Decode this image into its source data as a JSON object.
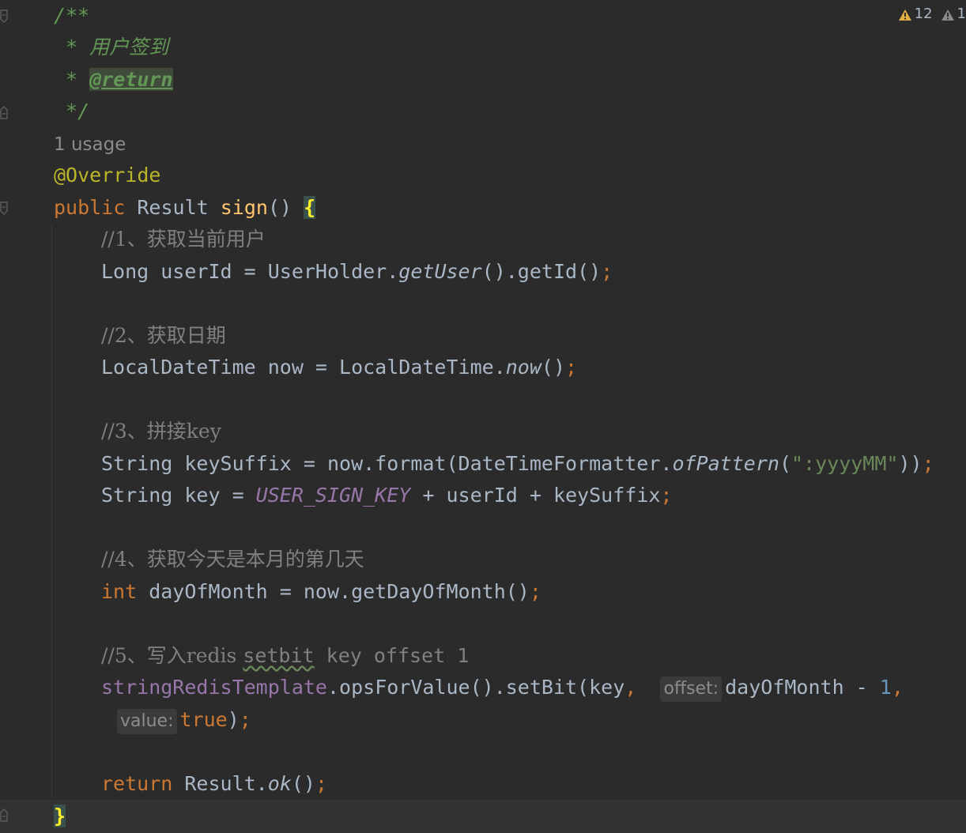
{
  "inspection": {
    "warnings_count": "12",
    "weak_warnings_count": "1"
  },
  "code": {
    "doc_open": "/**",
    "doc_title_prefix": " * ",
    "doc_title": "用户签到",
    "doc_tag_prefix": " * ",
    "doc_tag": "@return",
    "doc_close": " */",
    "usage_hint": "1 usage",
    "annotation": "@Override",
    "sig_public": "public",
    "sig_type": " Result ",
    "sig_method": "sign",
    "sig_parens": "() ",
    "sig_brace": "{",
    "comment1": "//1、获取当前用户",
    "l1_type": "Long userId = UserHolder.",
    "l1_static": "getUser",
    "l1_rest": "().getId()",
    "semi": ";",
    "comment2": "//2、获取日期",
    "l2_type": "LocalDateTime now = LocalDateTime.",
    "l2_static": "now",
    "l2_rest": "()",
    "comment3": "//3、拼接key",
    "l3_a": "String keySuffix = now.format(DateTimeFormatter.",
    "l3_static": "ofPattern",
    "l3_open": "(",
    "l3_str": "\":yyyyMM\"",
    "l3_close": "))",
    "l4_a": "String key = ",
    "l4_const": "USER_SIGN_KEY",
    "l4_b": " + userId + keySuffix",
    "comment4": "//4、获取今天是本月的第几天",
    "l5_kw": "int",
    "l5_rest": " dayOfMonth = now.getDayOfMonth()",
    "comment5_a": "//5、写入redis ",
    "comment5_typo": "setbit",
    "comment5_b": " key offset 1",
    "l6_field": "stringRedisTemplate",
    "l6_a": ".opsForValue().setBit(key",
    "comma": ",",
    "hint_offset": "offset:",
    "l6_b": "dayOfMonth - ",
    "l6_num": "1",
    "hint_value": "value:",
    "l7_kw": "true",
    "l7_close": ")",
    "l8_kw": "return",
    "l8_a": " Result.",
    "l8_static": "ok",
    "l8_b": "()",
    "closing_brace": "}"
  },
  "icons": [
    "fold-icon",
    "warning-icon",
    "weak-warning-icon"
  ],
  "colors": {
    "background": "#2b2b2b",
    "doc_comment": "#629755",
    "keyword": "#cc7832",
    "method": "#ffc66d",
    "annotation": "#bbb529",
    "constant": "#9876aa",
    "string": "#6a8759",
    "number": "#6897bb",
    "comment": "#808080",
    "warning": "#e0b040"
  }
}
